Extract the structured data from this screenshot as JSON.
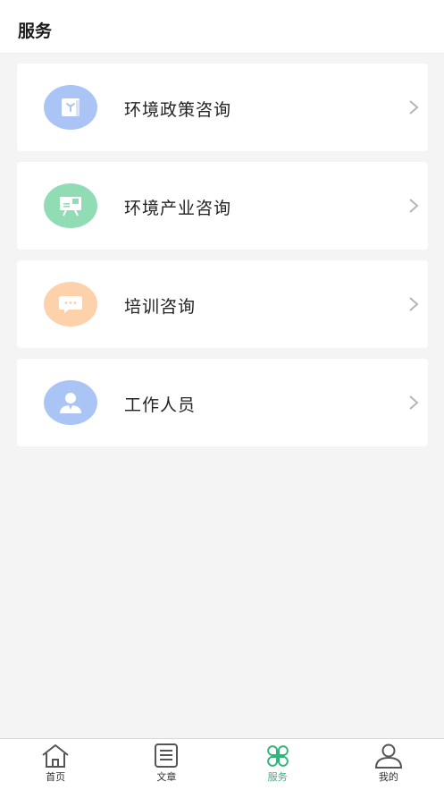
{
  "header": {
    "title": "服务"
  },
  "services": [
    {
      "label": "环境政策咨询",
      "icon": "policy-book-icon",
      "color": "#a9c4f5"
    },
    {
      "label": "环境产业咨询",
      "icon": "presentation-board-icon",
      "color": "#8fdcb5"
    },
    {
      "label": "培训咨询",
      "icon": "chat-bubble-icon",
      "color": "#fdd2aa"
    },
    {
      "label": "工作人员",
      "icon": "staff-person-icon",
      "color": "#a9c4f5"
    }
  ],
  "tabbar": {
    "tabs": [
      {
        "label": "首页",
        "icon": "home-icon",
        "active": false
      },
      {
        "label": "文章",
        "icon": "article-icon",
        "active": false
      },
      {
        "label": "服务",
        "icon": "clover-icon",
        "active": true
      },
      {
        "label": "我的",
        "icon": "user-icon",
        "active": false
      }
    ],
    "active_color": "#2fb67c"
  }
}
